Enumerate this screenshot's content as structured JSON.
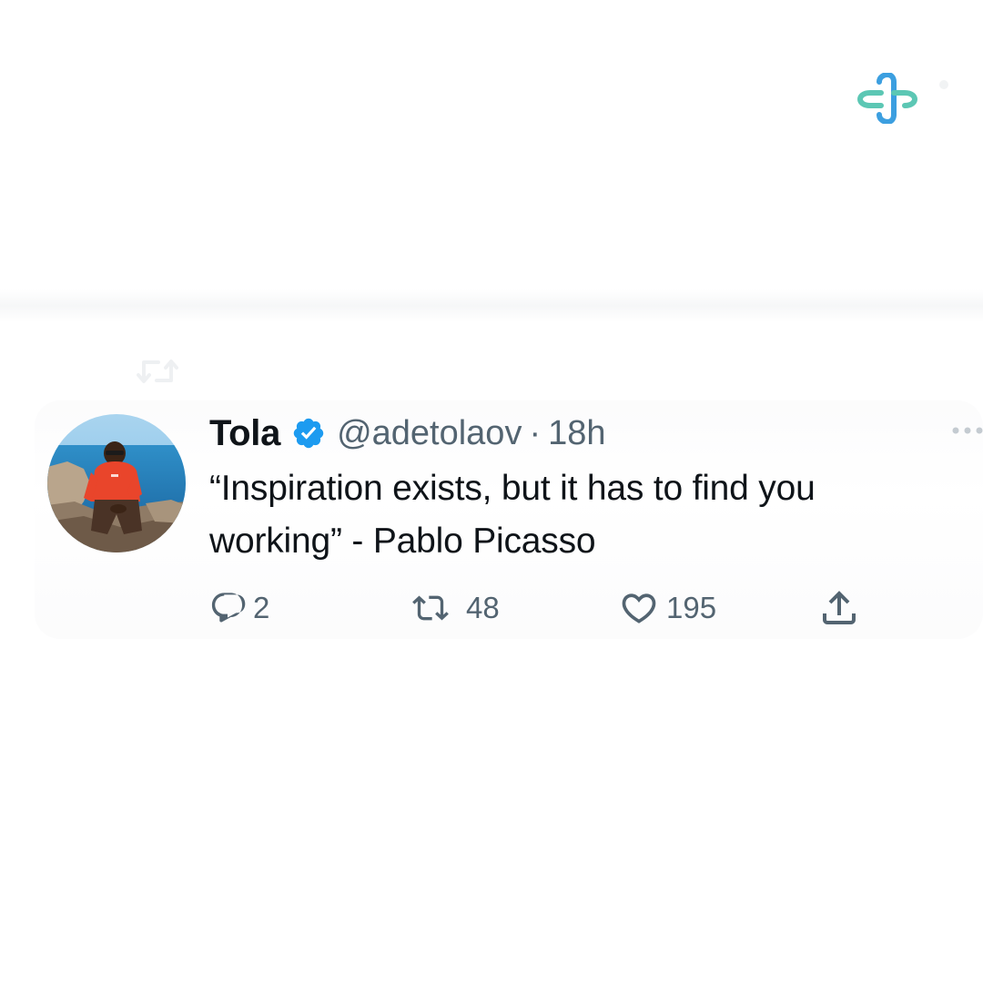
{
  "brand": {
    "logo_icon": "medical-cross-logo-icon",
    "colors": {
      "teal": "#5cc7b4",
      "blue": "#3c9fe0"
    }
  },
  "retweet_context": {
    "icon": "retweet-icon",
    "text": ""
  },
  "tweet": {
    "author_name": "Tola",
    "verified_icon": "verified-badge-icon",
    "handle": "@adetolaov",
    "separator": "·",
    "time": "18h",
    "text": "“Inspiration exists, but it has to find you working” - Pablo Picasso",
    "more_icon": "more-options-icon",
    "actions": {
      "reply": {
        "icon": "reply-icon",
        "count": "2"
      },
      "retweet": {
        "icon": "retweet-icon",
        "count": "48"
      },
      "like": {
        "icon": "heart-icon",
        "count": "195"
      },
      "share": {
        "icon": "share-icon"
      }
    }
  },
  "colors": {
    "text_primary": "#0f1419",
    "text_secondary": "#536471",
    "verified_blue": "#1d9bf0"
  }
}
